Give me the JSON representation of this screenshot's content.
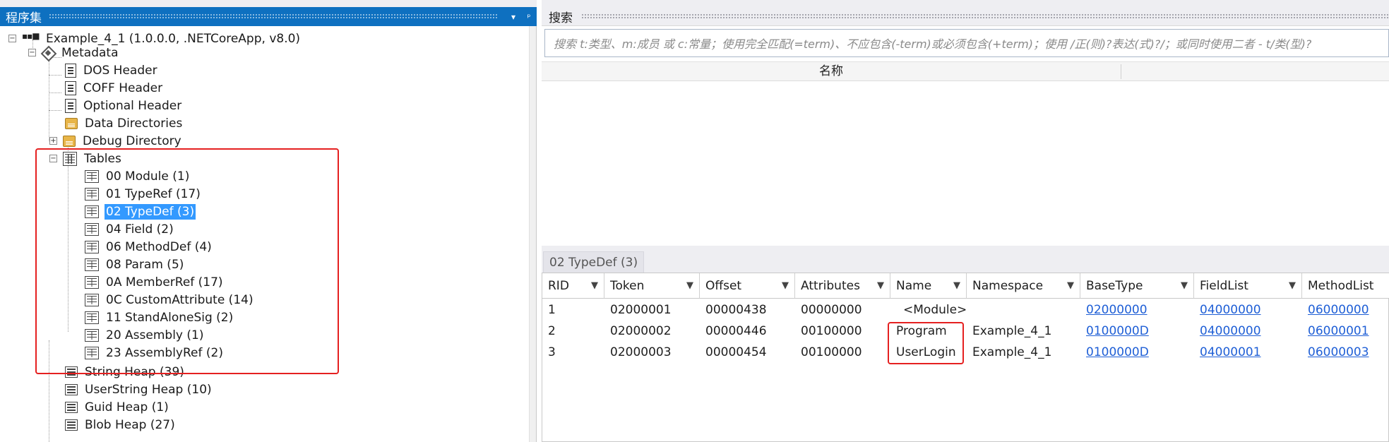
{
  "assembly_panel": {
    "title": "程序集",
    "header_buttons": [
      "▾",
      "ᵖ"
    ],
    "tree": {
      "root": "Example_4_1 (1.0.0.0, .NETCoreApp, v8.0)",
      "metadata": "Metadata",
      "metadata_children": [
        {
          "label": "DOS Header",
          "icon": "document-icon"
        },
        {
          "label": "COFF Header",
          "icon": "document-icon"
        },
        {
          "label": "Optional Header",
          "icon": "document-icon"
        },
        {
          "label": "Data Directories",
          "icon": "folder-table-icon"
        },
        {
          "label": "Debug Directory",
          "icon": "folder-table-icon"
        }
      ],
      "tables": "Tables",
      "tables_children": [
        "00 Module (1)",
        "01 TypeRef (17)",
        "02 TypeDef (3)",
        "04 Field (2)",
        "06 MethodDef (4)",
        "08 Param (5)",
        "0A MemberRef (17)",
        "0C CustomAttribute (14)",
        "11 StandAloneSig (2)",
        "20 Assembly (1)",
        "23 AssemblyRef (2)"
      ],
      "selected": "02 TypeDef (3)",
      "heaps": [
        "String Heap (39)",
        "UserString Heap (10)",
        "Guid Heap (1)",
        "Blob Heap (27)"
      ]
    }
  },
  "search_panel": {
    "title": "搜索",
    "placeholder": "搜索 t:类型、m:成员 或 c:常量；使用完全匹配(=term)、不应包含(-term)或必须包含(+term)；使用 /正(则)?表达(式)?/；或同时使用二者 - t/类(型)?",
    "results_column": "名称"
  },
  "table_view": {
    "tab_label": "02 TypeDef (3)",
    "columns": [
      "RID",
      "Token",
      "Offset",
      "Attributes",
      "Name",
      "Namespace",
      "BaseType",
      "FieldList",
      "MethodList"
    ],
    "filter_icon": "▼",
    "rows": [
      {
        "RID": "1",
        "Token": "02000001",
        "Offset": "00000438",
        "Attributes": "00000000",
        "Name": "<Module>",
        "Namespace": "",
        "BaseType": "02000000",
        "FieldList": "04000000",
        "MethodList": "06000000"
      },
      {
        "RID": "2",
        "Token": "02000002",
        "Offset": "00000446",
        "Attributes": "00100000",
        "Name": "Program",
        "Namespace": "Example_4_1",
        "BaseType": "0100000D",
        "FieldList": "04000000",
        "MethodList": "06000001"
      },
      {
        "RID": "3",
        "Token": "02000003",
        "Offset": "00000454",
        "Attributes": "00100000",
        "Name": "UserLogin",
        "Namespace": "Example_4_1",
        "BaseType": "0100000D",
        "FieldList": "04000001",
        "MethodList": "06000003"
      }
    ]
  },
  "colors": {
    "header_blue": "#0e70c0",
    "selection": "#3399ff",
    "link": "#1f5fd6",
    "highlight_box": "#e52020"
  }
}
